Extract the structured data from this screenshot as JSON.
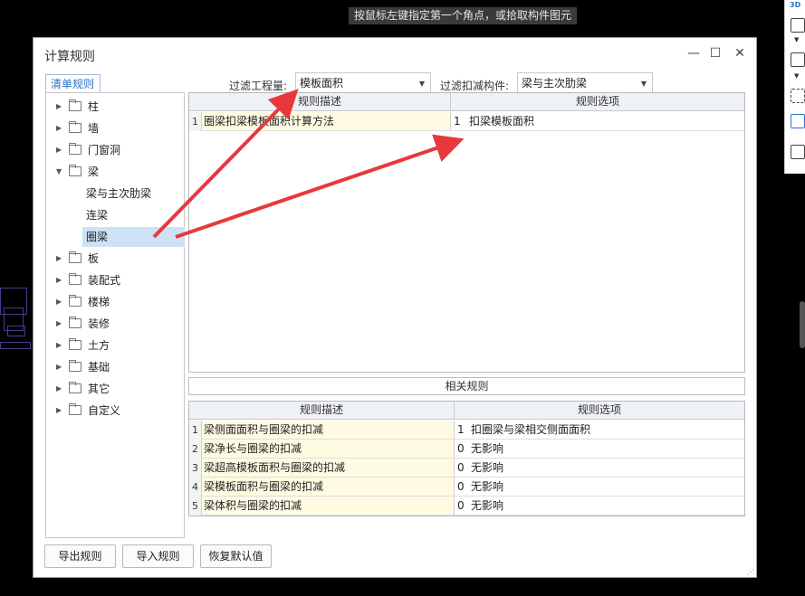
{
  "hint": "按鼠标左键指定第一个角点，或拾取构件图元",
  "toolbar": {
    "label_3d": "3D"
  },
  "dialog": {
    "title": "计算规则",
    "minimize": "—",
    "maximize": "☐",
    "close": "✕"
  },
  "tab": "清单规则",
  "filter": {
    "quantity_label": "过滤工程量:",
    "quantity_value": "模板面积",
    "component_label": "过滤扣减构件:",
    "component_value": "梁与主次肋梁"
  },
  "tree": [
    {
      "label": "柱",
      "expanded": false
    },
    {
      "label": "墙",
      "expanded": false
    },
    {
      "label": "门窗洞",
      "expanded": false
    },
    {
      "label": "梁",
      "expanded": true
    },
    {
      "label": "梁与主次肋梁",
      "child": true
    },
    {
      "label": "连梁",
      "child": true
    },
    {
      "label": "圈梁",
      "child": true,
      "selected": true
    },
    {
      "label": "板",
      "expanded": false
    },
    {
      "label": "装配式",
      "expanded": false
    },
    {
      "label": "楼梯",
      "expanded": false
    },
    {
      "label": "装修",
      "expanded": false
    },
    {
      "label": "土方",
      "expanded": false
    },
    {
      "label": "基础",
      "expanded": false
    },
    {
      "label": "其它",
      "expanded": false
    },
    {
      "label": "自定义",
      "expanded": false
    }
  ],
  "main_grid": {
    "headers": [
      "规则描述",
      "规则选项"
    ],
    "rows": [
      {
        "num": "1",
        "desc": "圈梁扣梁模板面积计算方法",
        "opt_num": "1",
        "opt_text": "扣梁模板面积"
      }
    ]
  },
  "related_label": "相关规则",
  "related_grid": {
    "headers": [
      "规则描述",
      "规则选项"
    ],
    "rows": [
      {
        "num": "1",
        "desc": "梁侧面面积与圈梁的扣减",
        "opt_num": "1",
        "opt_text": "扣圈梁与梁相交侧面面积"
      },
      {
        "num": "2",
        "desc": "梁净长与圈梁的扣减",
        "opt_num": "0",
        "opt_text": "无影响"
      },
      {
        "num": "3",
        "desc": "梁超高模板面积与圈梁的扣减",
        "opt_num": "0",
        "opt_text": "无影响"
      },
      {
        "num": "4",
        "desc": "梁模板面积与圈梁的扣减",
        "opt_num": "0",
        "opt_text": "无影响"
      },
      {
        "num": "5",
        "desc": "梁体积与圈梁的扣减",
        "opt_num": "0",
        "opt_text": "无影响"
      }
    ]
  },
  "buttons": {
    "export": "导出规则",
    "import": "导入规则",
    "restore": "恢复默认值"
  },
  "colors": {
    "annotation_arrow": "#e8383d",
    "selection": "#cde1f7",
    "desc_cell": "#fffbe3"
  }
}
